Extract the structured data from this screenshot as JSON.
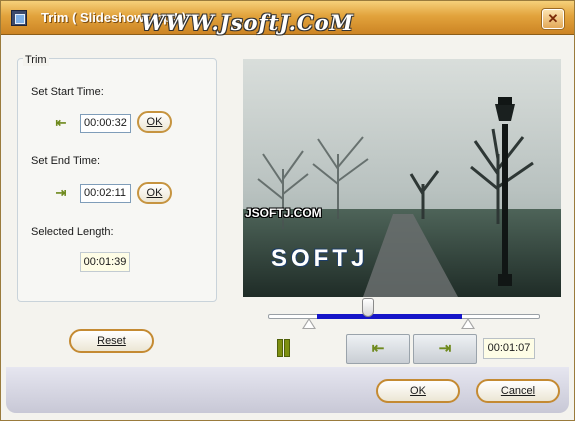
{
  "window": {
    "title": "Trim ( Slideshow .mp4 )",
    "watermark": "WWW.JsoftJ.CoM",
    "close_glyph": "✕"
  },
  "trim": {
    "group_label": "Trim",
    "start": {
      "label": "Set Start Time:",
      "value": "00:00:32",
      "ok_label": "OK",
      "icon": "set-start-icon"
    },
    "end": {
      "label": "Set End Time:",
      "value": "00:02:11",
      "ok_label": "OK",
      "icon": "set-end-icon"
    },
    "length": {
      "label": "Selected Length:",
      "value": "00:01:39"
    },
    "reset_label": "Reset"
  },
  "preview": {
    "watermark_text": "JSOFTJ.COM",
    "watermark_logo": "SOFTJ"
  },
  "slider": {
    "position": 0.37,
    "selection_start": 0.18,
    "selection_end": 0.72
  },
  "playback": {
    "pause_icon": "pause-icon",
    "set_start_glyph": "⇤",
    "set_end_glyph": "⇥",
    "current_time": "00:01:07"
  },
  "dialog": {
    "ok_label": "OK",
    "cancel_label": "Cancel"
  },
  "colors": {
    "titlebar": "#e2a33c",
    "selection": "#1515c8",
    "button_border": "#c48a32"
  }
}
